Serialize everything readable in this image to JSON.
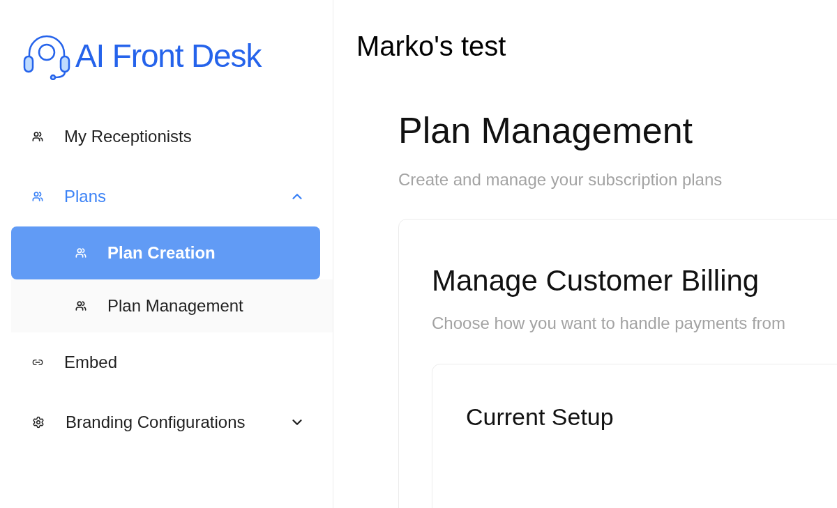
{
  "logo": {
    "text": "AI Front Desk"
  },
  "sidebar": {
    "items": [
      {
        "label": "My Receptionists",
        "selected": false
      },
      {
        "label": "Plans",
        "selected": false,
        "expanded": true,
        "children": [
          {
            "label": "Plan Creation",
            "selected": true
          },
          {
            "label": "Plan Management",
            "selected": false
          }
        ]
      },
      {
        "label": "Embed",
        "selected": false
      },
      {
        "label": "Branding Configurations",
        "selected": false,
        "expanded": false
      }
    ]
  },
  "header": {
    "title": "Marko's test"
  },
  "page": {
    "title": "Plan Management",
    "subtitle": "Create and manage your subscription plans",
    "card": {
      "title": "Manage Customer Billing",
      "subtitle": "Choose how you want to handle payments from",
      "inner_card": {
        "title": "Current Setup"
      }
    }
  }
}
